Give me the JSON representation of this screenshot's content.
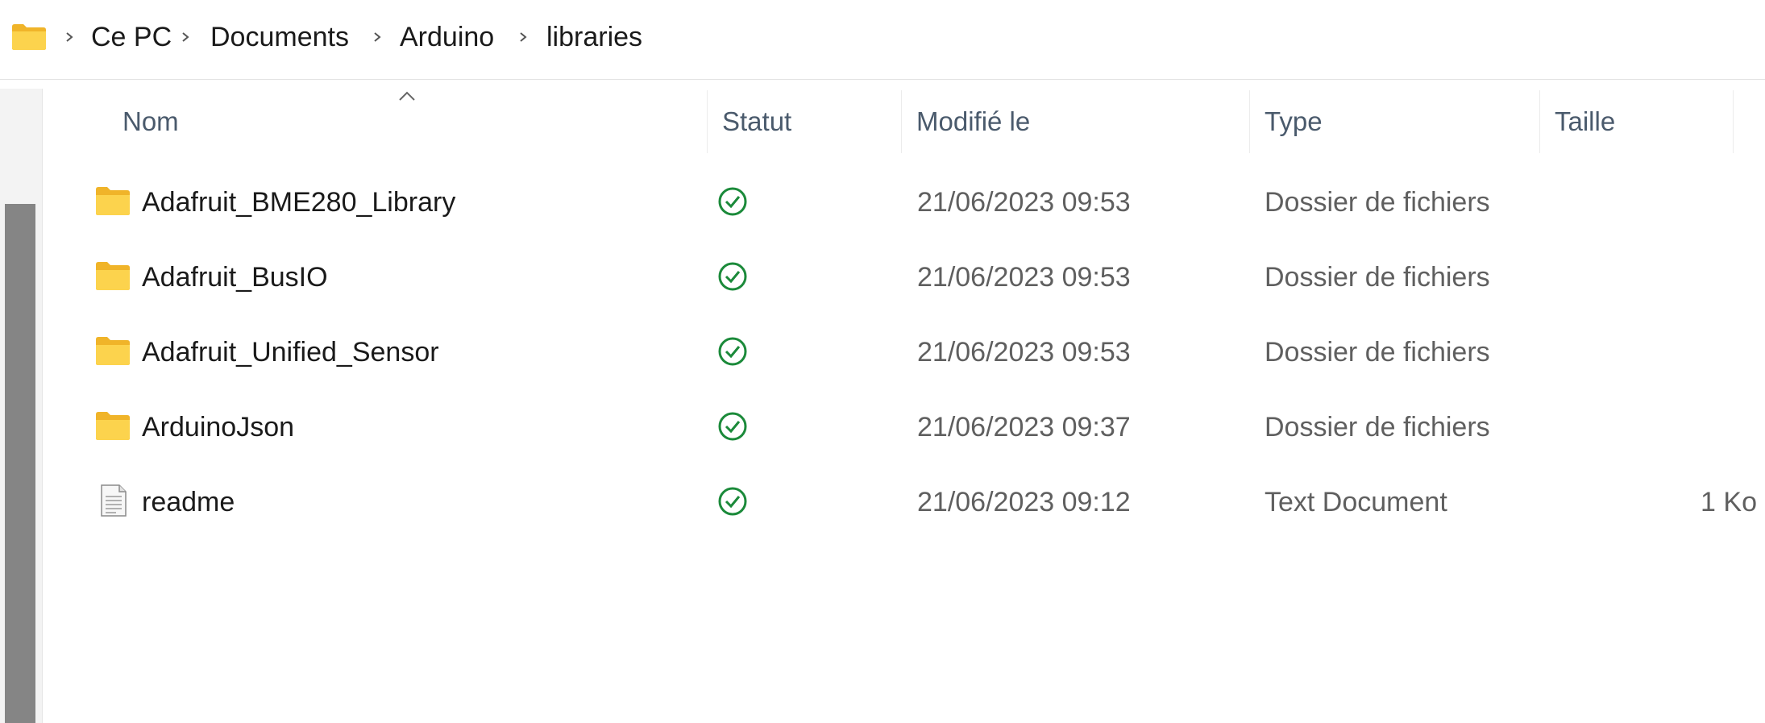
{
  "breadcrumb": {
    "items": [
      "Ce PC",
      "Documents",
      "Arduino",
      "libraries"
    ]
  },
  "columns": {
    "name": "Nom",
    "status": "Statut",
    "modified": "Modifié le",
    "type": "Type",
    "size": "Taille"
  },
  "files": [
    {
      "name": "Adafruit_BME280_Library",
      "icon": "folder-icon",
      "modified": "21/06/2023 09:53",
      "type": "Dossier de fichiers",
      "size": ""
    },
    {
      "name": "Adafruit_BusIO",
      "icon": "folder-icon",
      "modified": "21/06/2023 09:53",
      "type": "Dossier de fichiers",
      "size": ""
    },
    {
      "name": "Adafruit_Unified_Sensor",
      "icon": "folder-icon",
      "modified": "21/06/2023 09:53",
      "type": "Dossier de fichiers",
      "size": ""
    },
    {
      "name": "ArduinoJson",
      "icon": "folder-icon",
      "modified": "21/06/2023 09:37",
      "type": "Dossier de fichiers",
      "size": ""
    },
    {
      "name": "readme",
      "icon": "text-document-icon",
      "modified": "21/06/2023 09:12",
      "type": "Text Document",
      "size": "1 Ko"
    }
  ],
  "colors": {
    "status_ok": "#1b8a3a",
    "folder": "#f8c940",
    "header_text": "#4a5a6c"
  },
  "status_icon": "synced-check-icon"
}
